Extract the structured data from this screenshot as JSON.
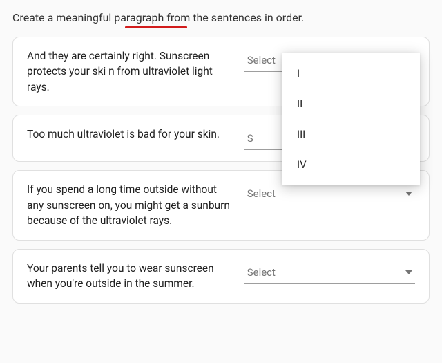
{
  "prompt": "Create a meaningful paragraph from the sentences in order.",
  "select_placeholder": "Select",
  "cards": [
    {
      "text": "And they are certainly right. Sunscreen protects your ski n from ultraviolet light rays."
    },
    {
      "text": "Too much ultraviolet is bad for your skin."
    },
    {
      "text": " If you spend a long time outside without any sunscreen on, you might get a sunburn because of the ultraviolet rays."
    },
    {
      "text": "Your parents tell you to wear sunscreen when you're outside in the summer."
    }
  ],
  "dropdown_options": [
    "I",
    "II",
    "III",
    "IV"
  ]
}
